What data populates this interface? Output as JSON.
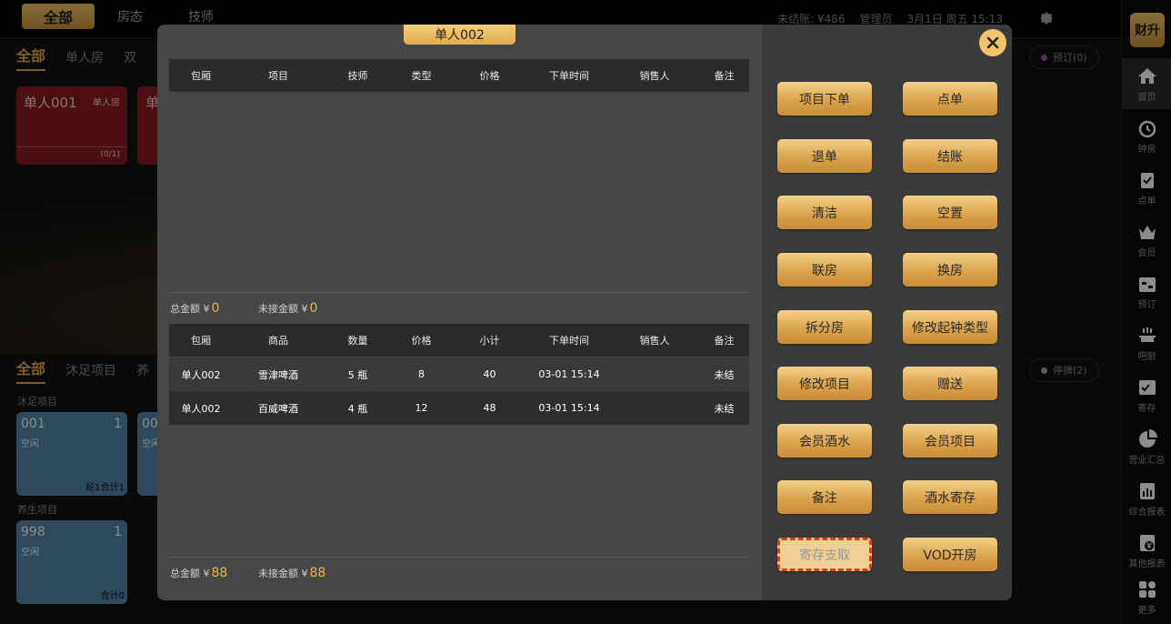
{
  "topbar": {
    "tabs": [
      "全部",
      "房态",
      "技师"
    ],
    "status": {
      "unsettled": "未结账: ¥486",
      "role": "管理员",
      "datetime": "3月1日 周五 15:13"
    }
  },
  "rooms_section": {
    "tabs": [
      "全部",
      "单人房",
      "双"
    ],
    "reserve_pill": "预订(0)",
    "cards": [
      {
        "name": "单人001",
        "type": "单人房",
        "count": "(0/1)"
      },
      {
        "name": "单",
        "type": "",
        "count": ""
      }
    ]
  },
  "service_section": {
    "tabs": [
      "全部",
      "沐足项目",
      "养"
    ],
    "stop_pill": "停牌(2)",
    "groups": [
      {
        "label": "沐足项目",
        "cards": [
          {
            "code": "001",
            "num": "1",
            "status": "空闲",
            "footer": "轮1合计1"
          },
          {
            "code": "00",
            "num": "",
            "status": "空闲",
            "footer": ""
          }
        ]
      },
      {
        "label": "养生项目",
        "cards": [
          {
            "code": "998",
            "num": "1",
            "status": "空闲",
            "footer": "合计0"
          }
        ]
      }
    ]
  },
  "sidebar": {
    "logo": "财升",
    "items": [
      {
        "label": "首页",
        "icon": "home-icon",
        "active": true
      },
      {
        "label": "钟房",
        "icon": "clock-icon"
      },
      {
        "label": "点单",
        "icon": "clipboard-icon"
      },
      {
        "label": "会员",
        "icon": "crown-icon"
      },
      {
        "label": "预订",
        "icon": "calendar-icon"
      },
      {
        "label": "吧厨",
        "icon": "chef-icon"
      },
      {
        "label": "寄存",
        "icon": "storage-icon"
      },
      {
        "label": "营业汇总",
        "icon": "pie-icon"
      },
      {
        "label": "综合报表",
        "icon": "report-icon"
      },
      {
        "label": "其他报表",
        "icon": "yen-report-icon"
      },
      {
        "label": "更多",
        "icon": "more-icon"
      }
    ]
  },
  "modal": {
    "room_title": "单人002",
    "project_table": {
      "headers": [
        "包厢",
        "项目",
        "技师",
        "类型",
        "价格",
        "下单时间",
        "销售人",
        "备注"
      ],
      "rows": []
    },
    "project_summary": {
      "total_label": "总金额 ¥",
      "total_value": "0",
      "unpaid_label": "未接金额 ¥",
      "unpaid_value": "0"
    },
    "goods_table": {
      "headers": [
        "包厢",
        "商品",
        "数量",
        "价格",
        "小计",
        "下单时间",
        "销售人",
        "备注"
      ],
      "rows": [
        [
          "单人002",
          "雪津啤酒",
          "5 瓶",
          "8",
          "40",
          "03-01 15:14",
          "",
          "未结"
        ],
        [
          "单人002",
          "百威啤酒",
          "4 瓶",
          "12",
          "48",
          "03-01 15:14",
          "",
          "未结"
        ]
      ]
    },
    "goods_summary": {
      "total_label": "总金额 ¥",
      "total_value": "88",
      "unpaid_label": "未接金额 ¥",
      "unpaid_value": "88"
    },
    "actions": [
      "项目下单",
      "点单",
      "退单",
      "结账",
      "清洁",
      "空置",
      "联房",
      "换房",
      "拆分房",
      "修改起钟类型",
      "修改项目",
      "赠送",
      "会员酒水",
      "会员项目",
      "备注",
      "酒水寄存",
      "寄存支取",
      "VOD开房"
    ],
    "disabled_action": "寄存支取"
  },
  "colors": {
    "accent_gold": "#e8b04a",
    "room_red": "#8b1a24",
    "service_blue": "#5585a6",
    "warning_border": "#d6441c"
  }
}
